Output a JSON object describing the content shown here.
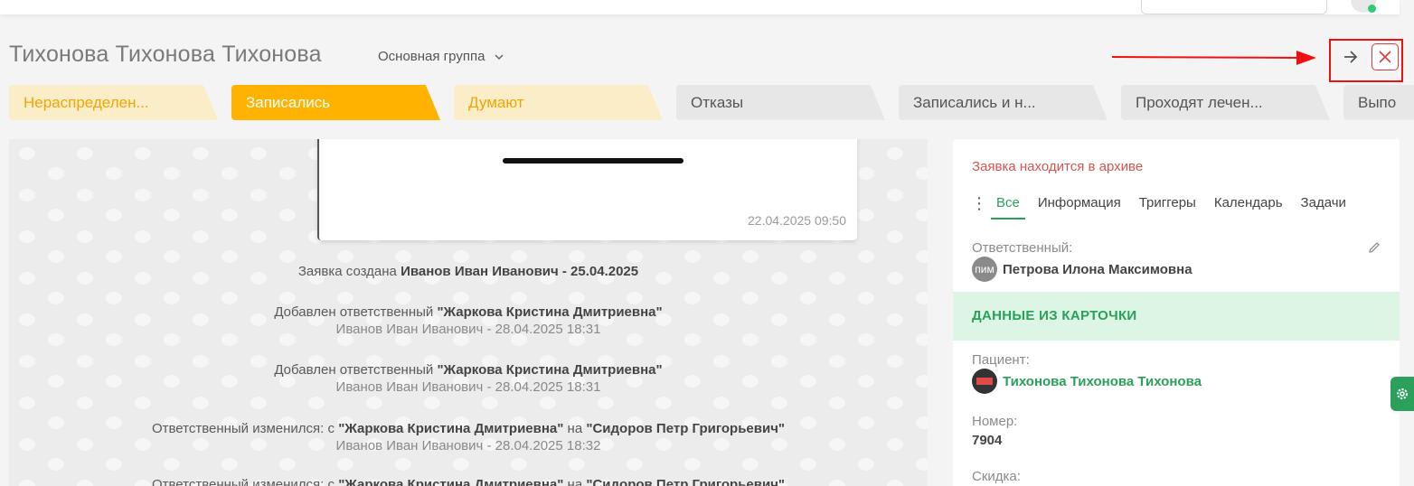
{
  "header": {
    "title": "Тихонова Тихонова Тихонова",
    "group_label": "Основная группа"
  },
  "stages": [
    {
      "label": "Нераспределен...",
      "style": "pale"
    },
    {
      "label": "Записались",
      "style": "active"
    },
    {
      "label": "Думают",
      "style": "pale"
    },
    {
      "label": "Отказы",
      "style": "grey"
    },
    {
      "label": "Записались и н...",
      "style": "grey"
    },
    {
      "label": "Проходят лечен...",
      "style": "grey"
    },
    {
      "label": "Выпо",
      "style": "grey"
    }
  ],
  "feed": {
    "message_time": "22.04.2025 09:50",
    "events": [
      {
        "prefix": "Заявка создана ",
        "strong": "Иванов Иван Иванович - 25.04.2025",
        "sub": ""
      },
      {
        "prefix": "Добавлен ответственный ",
        "strong": "\"Жаркова Кристина Дмитриевна\"",
        "sub": "Иванов Иван Иванович - 28.04.2025 18:31"
      },
      {
        "prefix": "Добавлен ответственный ",
        "strong": "\"Жаркова Кристина Дмитриевна\"",
        "sub": "Иванов Иван Иванович - 28.04.2025 18:31"
      },
      {
        "prefix": "Ответственный изменился: с ",
        "strong": "\"Жаркова Кристина Дмитриевна\"",
        "mid": " на ",
        "strong2": "\"Сидоров Петр Григорьевич\"",
        "sub": "Иванов Иван Иванович - 28.04.2025 18:32"
      },
      {
        "prefix": "Ответственный изменился: с ",
        "strong": "\"Жаркова Кристина Дмитриевна\"",
        "mid": " на ",
        "strong2": "\"Сидоров Петр Григорьевич\"",
        "sub": ""
      }
    ]
  },
  "side": {
    "archive_notice": "Заявка находится в архиве",
    "tabs": [
      "Все",
      "Информация",
      "Триггеры",
      "Календарь",
      "Задачи"
    ],
    "active_tab": "Все",
    "responsible_label": "Ответственный:",
    "responsible_initials": "пим",
    "responsible_name": "Петрова Илона Максимовна",
    "section_title": "ДАННЫЕ ИЗ КАРТОЧКИ",
    "patient_label": "Пациент:",
    "patient_name": "Тихонова Тихонова Тихонова",
    "number_label": "Номер:",
    "number_value": "7904",
    "discount_label": "Скидка:"
  },
  "colors": {
    "accent_green": "#2aa05a",
    "stage_active": "#ffb300",
    "stage_pale": "#fbedc8",
    "stage_grey": "#e7e7e8",
    "archive_red": "#d9534f",
    "annotation_red": "#ee1111"
  },
  "icons": [
    "chevron-down-icon",
    "arrow-right-icon",
    "close-icon",
    "pencil-icon",
    "gear-icon",
    "more-vertical-icon"
  ]
}
